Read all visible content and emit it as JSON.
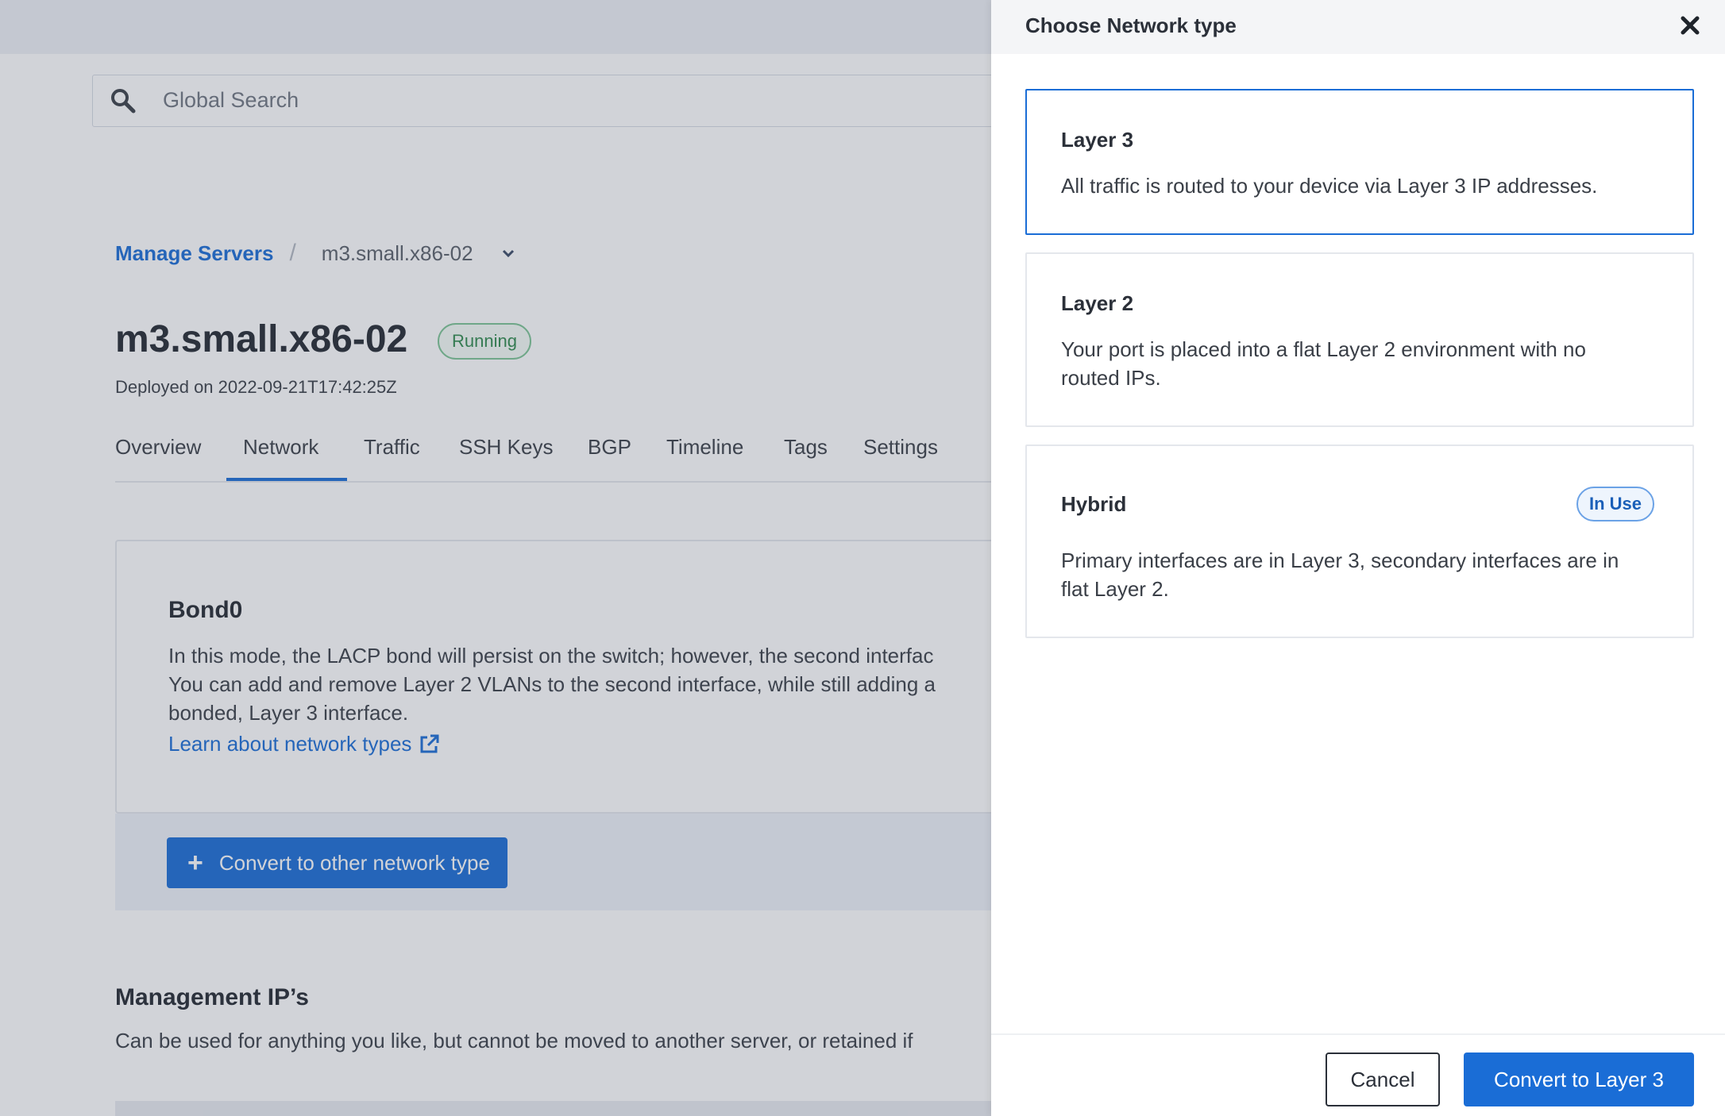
{
  "search": {
    "placeholder": "Global Search",
    "icon": "search-icon"
  },
  "breadcrumb": {
    "parent": "Manage Servers",
    "separator": "/",
    "current": "m3.small.x86-02"
  },
  "server": {
    "name": "m3.small.x86-02",
    "status": "Running",
    "deployed": "Deployed on 2022-09-21T17:42:25Z"
  },
  "tabs": [
    "Overview",
    "Network",
    "Traffic",
    "SSH Keys",
    "BGP",
    "Timeline",
    "Tags",
    "Settings"
  ],
  "active_tab": "Network",
  "bond": {
    "title": "Bond0",
    "desc_line1": "In this mode, the LACP bond will persist on the switch; however, the second interfac",
    "desc_line2": "You can add and remove Layer 2 VLANs to the second interface, while still adding a",
    "desc_line3": "bonded, Layer 3 interface.",
    "learn_link": "Learn about network types",
    "convert_button": "Convert to other network type"
  },
  "management": {
    "title": "Management IP’s",
    "desc": "Can be used for anything you like, but cannot be moved to another server, or retained if"
  },
  "drawer": {
    "title": "Choose Network type",
    "options": [
      {
        "title": "Layer 3",
        "line1": "All traffic is routed to your device via Layer 3 IP addresses.",
        "line2": "",
        "selected": true
      },
      {
        "title": "Layer 2",
        "line1": "Your port is placed into a flat Layer 2 environment with no",
        "line2": "routed IPs.",
        "selected": false
      },
      {
        "title": "Hybrid",
        "line1": "Primary interfaces are in Layer 3, secondary interfaces are in",
        "line2": "flat Layer 2.",
        "selected": false,
        "badge": "In Use"
      }
    ],
    "cancel": "Cancel",
    "confirm": "Convert to Layer 3"
  },
  "colors": {
    "accent": "#1a6dd6",
    "running": "#2f8a4d",
    "overlay": "rgba(70,80,100,0.25)"
  }
}
